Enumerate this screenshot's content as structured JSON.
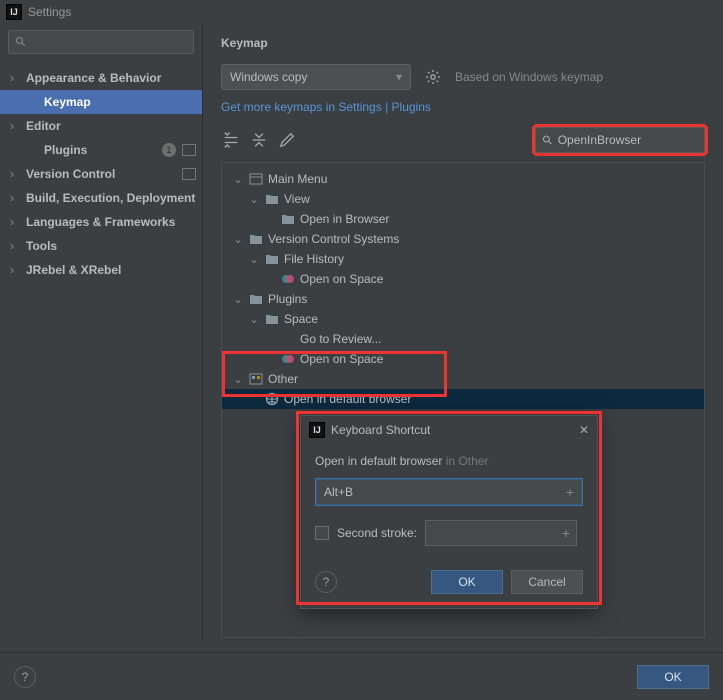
{
  "title": "Settings",
  "sidebar": {
    "items": [
      {
        "label": "Appearance & Behavior",
        "expandable": true
      },
      {
        "label": "Keymap",
        "selected": true,
        "indent": 1
      },
      {
        "label": "Editor",
        "expandable": true
      },
      {
        "label": "Plugins",
        "indent": 1,
        "badge": "1",
        "tag": true
      },
      {
        "label": "Version Control",
        "expandable": true,
        "tag": true
      },
      {
        "label": "Build, Execution, Deployment",
        "expandable": true
      },
      {
        "label": "Languages & Frameworks",
        "expandable": true
      },
      {
        "label": "Tools",
        "expandable": true
      },
      {
        "label": "JRebel & XRebel",
        "expandable": true
      }
    ]
  },
  "main": {
    "title": "Keymap",
    "scheme": "Windows copy",
    "based_on": "Based on Windows keymap",
    "link": "Get more keymaps in Settings | Plugins",
    "search_value": "OpenInBrowser"
  },
  "tree": [
    {
      "depth": 0,
      "exp": true,
      "icon": "panel",
      "label": "Main Menu"
    },
    {
      "depth": 1,
      "exp": true,
      "icon": "folder",
      "label": "View"
    },
    {
      "depth": 2,
      "exp": false,
      "icon": "folder",
      "label": "Open in Browser"
    },
    {
      "depth": 0,
      "exp": true,
      "icon": "folder",
      "label": "Version Control Systems"
    },
    {
      "depth": 1,
      "exp": true,
      "icon": "folder",
      "label": "File History"
    },
    {
      "depth": 2,
      "exp": false,
      "icon": "space",
      "label": "Open on Space"
    },
    {
      "depth": 0,
      "exp": true,
      "icon": "folder",
      "label": "Plugins"
    },
    {
      "depth": 1,
      "exp": true,
      "icon": "folder",
      "label": "Space"
    },
    {
      "depth": 2,
      "exp": false,
      "icon": "none",
      "label": "Go to Review..."
    },
    {
      "depth": 2,
      "exp": false,
      "icon": "space",
      "label": "Open on Space"
    },
    {
      "depth": 0,
      "exp": true,
      "icon": "other",
      "label": "Other"
    },
    {
      "depth": 1,
      "exp": false,
      "icon": "globe",
      "label": "Open in default browser",
      "selected": true
    }
  ],
  "dialog": {
    "title": "Keyboard Shortcut",
    "action": "Open in default browser",
    "context": "in Other",
    "first_stroke": "Alt+B",
    "second_label": "Second stroke:",
    "ok": "OK",
    "cancel": "Cancel"
  },
  "bottom": {
    "ok": "OK"
  }
}
